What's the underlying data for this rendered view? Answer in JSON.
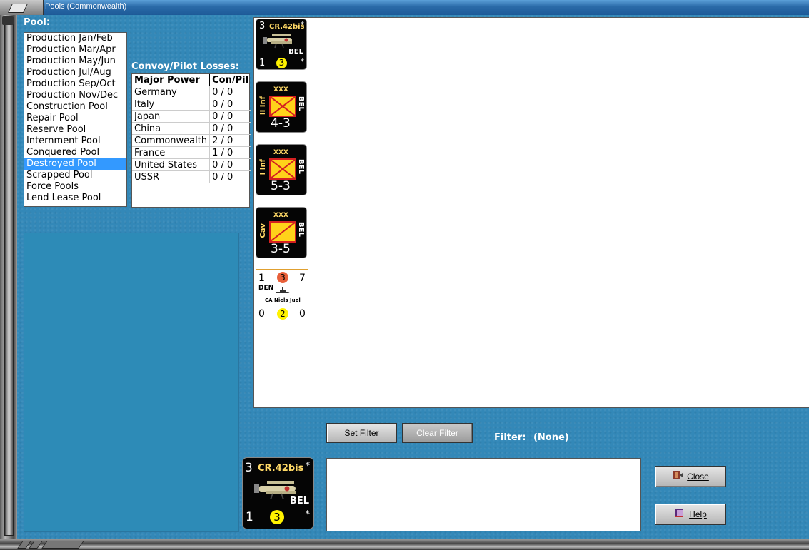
{
  "window": {
    "title": "Pools (Commonwealth)"
  },
  "pool": {
    "label": "Pool:",
    "items": [
      "Production Jan/Feb",
      "Production Mar/Apr",
      "Production May/Jun",
      "Production Jul/Aug",
      "Production Sep/Oct",
      "Production Nov/Dec",
      "Construction Pool",
      "Repair Pool",
      "Reserve Pool",
      "Internment Pool",
      "Conquered Pool",
      "Destroyed Pool",
      "Scrapped Pool",
      "Force Pools",
      "Lend Lease Pool"
    ],
    "selected": "Destroyed Pool"
  },
  "losses": {
    "label": "Convoy/Pilot Losses:",
    "headers": [
      "Major Power",
      "Con/Pil"
    ],
    "rows": [
      [
        "Germany",
        "0 / 0"
      ],
      [
        "Italy",
        "0 / 0"
      ],
      [
        "Japan",
        "0 / 0"
      ],
      [
        "China",
        "0 / 0"
      ],
      [
        "Commonwealth",
        "2 / 0"
      ],
      [
        "France",
        "1 / 0"
      ],
      [
        "United States",
        "0 / 0"
      ],
      [
        "USSR",
        "0 / 0"
      ]
    ]
  },
  "counters": {
    "air": {
      "top_left": "3",
      "name": "CR.42bis",
      "star": "*",
      "nation": "BEL",
      "bottom_left": "1",
      "circle": "3"
    },
    "land": [
      {
        "size": "XXX",
        "side": "II Inf",
        "nation": "BEL",
        "strength": "4-3"
      },
      {
        "size": "XXX",
        "side": "I Inf",
        "nation": "BEL",
        "strength": "5-3"
      },
      {
        "size": "XXX",
        "side": "Cav",
        "nation": "BEL",
        "strength": "3-5"
      }
    ],
    "naval": {
      "top_left": "1",
      "top_circle": "3",
      "top_right": "7",
      "nation": "DEN",
      "name": "CA Niels Juel",
      "bottom_left": "0",
      "bottom_circle": "2",
      "bottom_right": "0"
    }
  },
  "buttons": {
    "set_filter": "Set Filter",
    "clear_filter": "Clear Filter",
    "close": "Close",
    "help": "Help"
  },
  "filter": {
    "label": "Filter:",
    "value": "(None)"
  },
  "selected_counter": {
    "top_left": "3",
    "name": "CR.42bis",
    "star": "*",
    "nation": "BEL",
    "bottom_left": "1",
    "circle": "3"
  },
  "colors": {
    "background": "#3388b8",
    "selection": "#3399ff",
    "counter_bg": "#050505",
    "unit_yellow": "#ffd21a"
  },
  "icons": [
    "close-door-icon",
    "help-book-icon",
    "aircraft-icon",
    "ship-icon"
  ]
}
